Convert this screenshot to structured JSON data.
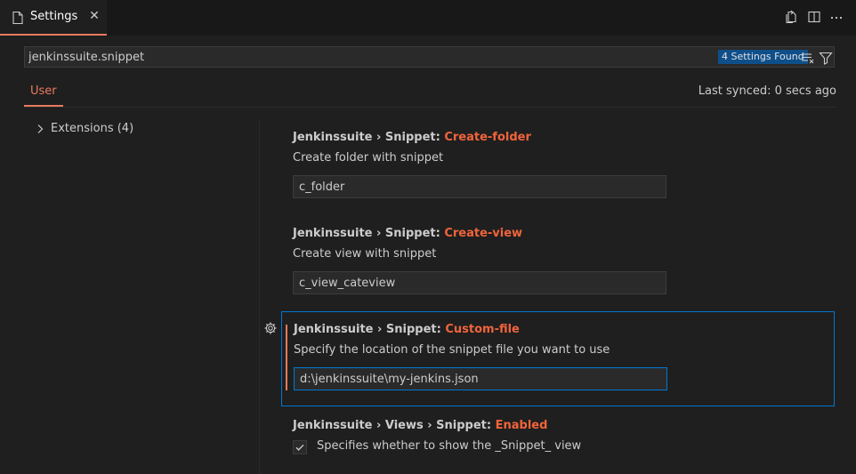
{
  "tab": {
    "label": "Settings"
  },
  "search": {
    "value": "jenkinssuite.snippet",
    "found_badge": "4 Settings Found"
  },
  "scope": {
    "user_tab": "User",
    "last_synced": "Last synced: 0 secs ago"
  },
  "toc": {
    "items": [
      {
        "label": "Extensions (4)"
      }
    ]
  },
  "settings": [
    {
      "category": "Jenkinssuite › Snippet: ",
      "key": "Create-folder",
      "description": "Create folder with snippet",
      "value": "c_folder"
    },
    {
      "category": "Jenkinssuite › Snippet: ",
      "key": "Create-view",
      "description": "Create view with snippet",
      "value": "c_view_cateview"
    },
    {
      "category": "Jenkinssuite › Snippet: ",
      "key": "Custom-file",
      "description": "Specify the location of the snippet file you want to use",
      "value": "d:\\jenkinssuite\\my-jenkins.json"
    },
    {
      "category": "Jenkinssuite › Views › Snippet: ",
      "key": "Enabled",
      "description": "Specifies whether to show the _Snippet_ view",
      "checked": true
    }
  ],
  "colors": {
    "accent": "#e87a5d",
    "setting_key": "#f0643c",
    "focus_border": "#0078d4",
    "badge_bg": "#0e4f8a"
  }
}
